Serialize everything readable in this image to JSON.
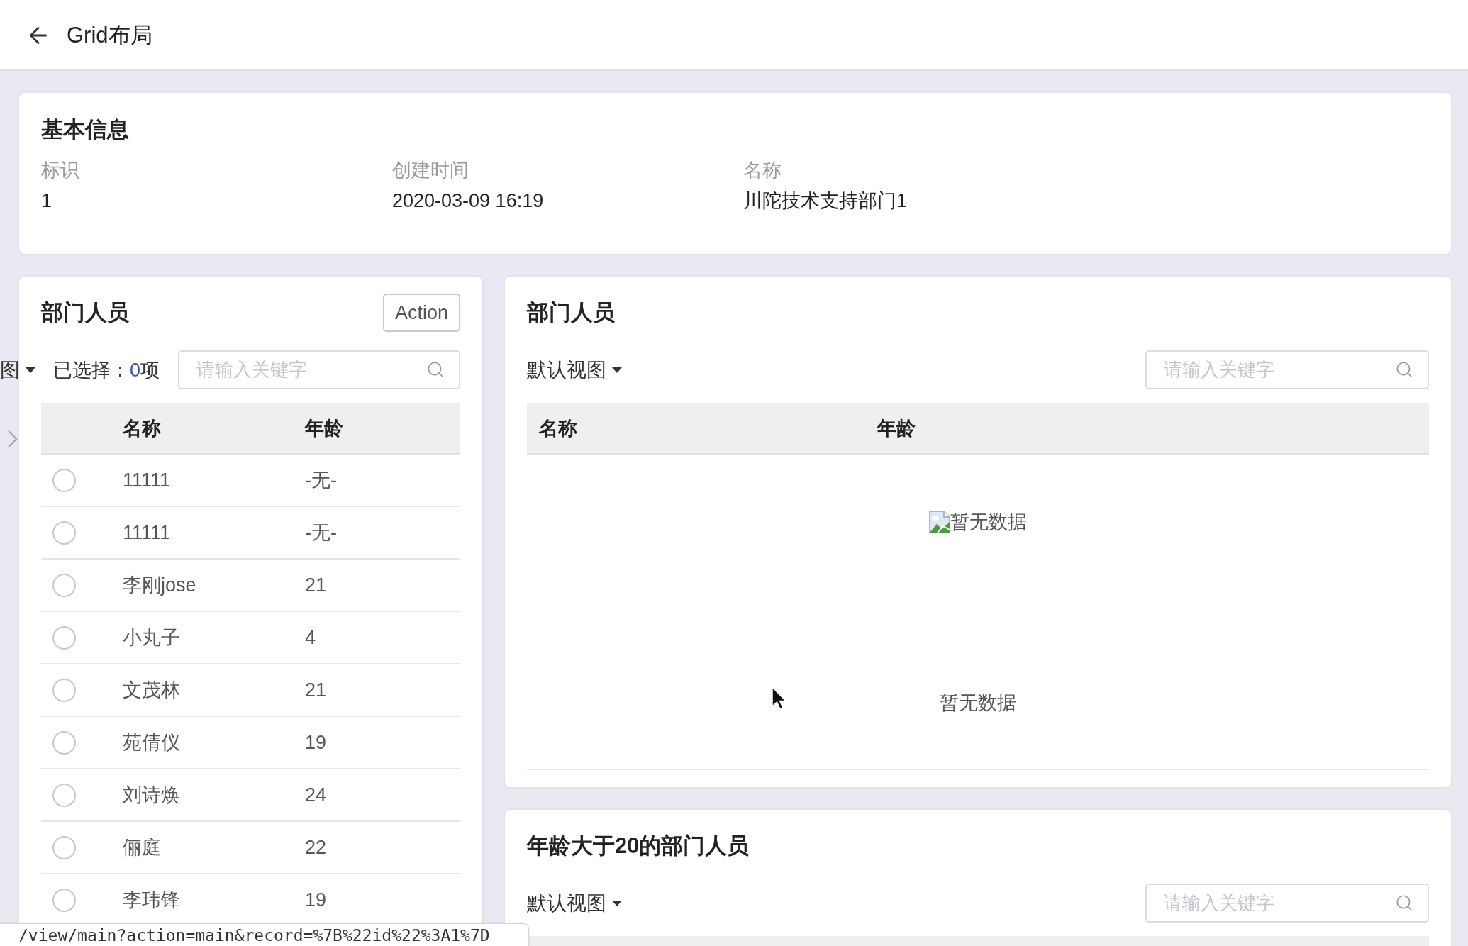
{
  "header": {
    "title": "Grid布局"
  },
  "basic_info": {
    "title": "基本信息",
    "fields": [
      {
        "label": "标识",
        "value": "1"
      },
      {
        "label": "创建时间",
        "value": "2020-03-09 16:19"
      },
      {
        "label": "名称",
        "value": "川陀技术支持部门1"
      }
    ]
  },
  "left_panel": {
    "title": "部门人员",
    "action_button": "Action",
    "view_selector": {
      "label": "图"
    },
    "selection": {
      "prefix": "已选择：",
      "count": "0",
      "suffix": "项"
    },
    "search": {
      "placeholder": "请输入关键字"
    },
    "table": {
      "columns": [
        "名称",
        "年龄"
      ],
      "rows": [
        {
          "name": "11111",
          "age": "-无-",
          "selected": false
        },
        {
          "name": "11111",
          "age": "-无-",
          "selected": false
        },
        {
          "name": "李刚jose",
          "age": "21",
          "selected": false
        },
        {
          "name": "小丸子",
          "age": "4",
          "selected": false
        },
        {
          "name": "文茂林",
          "age": "21",
          "selected": false
        },
        {
          "name": "苑倩仪",
          "age": "19",
          "selected": false
        },
        {
          "name": "刘诗焕",
          "age": "24",
          "selected": false
        },
        {
          "name": "俪庭",
          "age": "22",
          "selected": false
        },
        {
          "name": "李玮锋",
          "age": "19",
          "selected": false
        }
      ]
    }
  },
  "right_panels": [
    {
      "title": "部门人员",
      "view_selector": {
        "label": "默认视图"
      },
      "search": {
        "placeholder": "请输入关键字"
      },
      "table": {
        "columns": [
          "名称",
          "年龄"
        ],
        "empty": {
          "image_alt": "暂无数据",
          "text": "暂无数据"
        }
      }
    },
    {
      "title": "年龄大于20的部门人员",
      "view_selector": {
        "label": "默认视图"
      },
      "search": {
        "placeholder": "请输入关键字"
      }
    }
  ],
  "status_bar": {
    "url": "/view/main?action=main&record=%7B%22id%22%3A1%7D"
  }
}
